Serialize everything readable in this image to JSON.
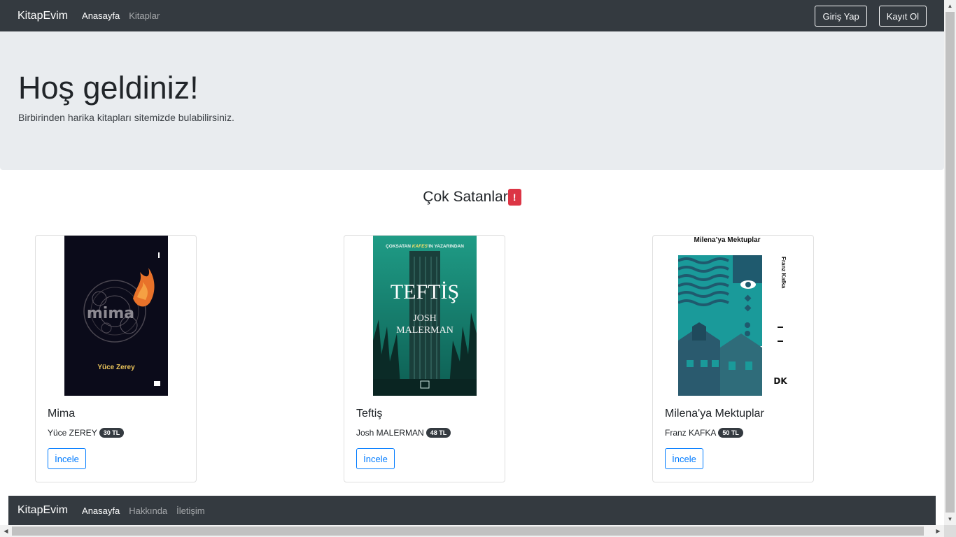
{
  "navbar": {
    "brand": "KitapEvim",
    "links": [
      "Anasayfa",
      "Kitaplar"
    ],
    "login_label": "Giriş Yap",
    "register_label": "Kayıt Ol"
  },
  "jumbotron": {
    "title": "Hoş geldiniz!",
    "subtitle": "Birbirinden harika kitapları sitemizde bulabilirsiniz."
  },
  "section": {
    "title": "Çok Satanlar",
    "badge": "!"
  },
  "books": [
    {
      "title": "Mima",
      "author": "Yüce ZEREY",
      "price": "30 TL",
      "button": "İncele",
      "cover": {
        "author_text": "Yüce Zerey",
        "title_text": "mima"
      }
    },
    {
      "title": "Teftiş",
      "author": "Josh MALERMAN",
      "price": "48 TL",
      "button": "İncele",
      "cover": {
        "top_text_1": "ÇOKSATAN ",
        "top_text_em": "KAFES",
        "top_text_2": "'IN YAZARINDAN",
        "title_text": "TEFTİŞ",
        "author_line1": "JOSH",
        "author_line2": "MALERMAN"
      }
    },
    {
      "title": "Milena'ya Mektuplar",
      "author": "Franz KAFKA",
      "price": "50 TL",
      "button": "İncele",
      "cover": {
        "title_text": "Milena’ya Mektuplar",
        "author_text": "Franz Kafka",
        "publisher": "DK"
      }
    }
  ],
  "footer": {
    "brand": "KitapEvim",
    "links": [
      "Anasayfa",
      "Hakkında",
      "İletişim"
    ]
  },
  "colors": {
    "dark": "#343a40",
    "jumbotron": "#e9ecef",
    "primary": "#007bff",
    "danger": "#dc3545"
  }
}
